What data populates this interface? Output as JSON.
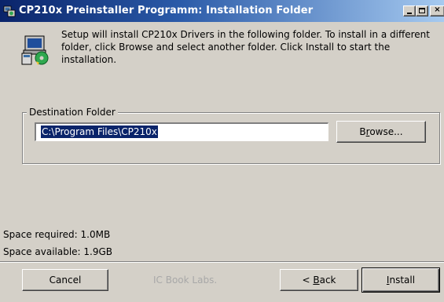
{
  "window": {
    "title": "CP210x Preinstaller Programm: Installation Folder",
    "icon": "installer-icon"
  },
  "intro": {
    "icon": "setup-icon",
    "text": "Setup will install CP210x Drivers in the following folder. To install in a different folder, click Browse and select another folder. Click Install to start the installation."
  },
  "destination": {
    "group_label": "Destination Folder",
    "value": "C:\\Program Files\\CP210x",
    "browse_label": "Browse...",
    "browse_label_pre": "B",
    "browse_label_mnemonic": "r",
    "browse_label_post": "owse..."
  },
  "space": {
    "required": "Space required: 1.0MB",
    "available": "Space available: 1.9GB"
  },
  "footer": {
    "brand": "IC Book Labs.",
    "cancel_label": "Cancel",
    "back_label": "< Back",
    "back_label_pre": "< ",
    "back_label_mnemonic": "B",
    "back_label_post": "ack",
    "install_label": "Install",
    "install_label_mnemonic": "I",
    "install_label_post": "nstall"
  }
}
